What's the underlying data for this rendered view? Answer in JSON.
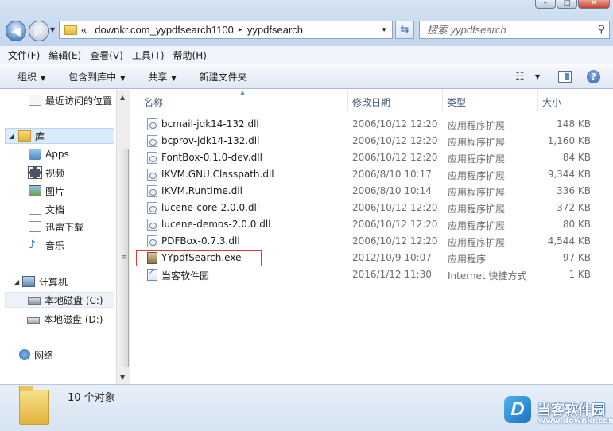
{
  "window": {
    "buttons": {
      "minimize": "–",
      "maximize": "□",
      "close": "✕"
    }
  },
  "address": {
    "overflow": "«",
    "crumbs": [
      "downkr.com_yypdfsearch1100",
      "yypdfsearch"
    ],
    "separator": "▸"
  },
  "search": {
    "placeholder": "搜索 yypdfsearch"
  },
  "menu": [
    "文件(F)",
    "编辑(E)",
    "查看(V)",
    "工具(T)",
    "帮助(H)"
  ],
  "commands": {
    "organize": "组织",
    "include_library": "包含到库中",
    "share": "共享",
    "new_folder": "新建文件夹"
  },
  "nav": {
    "recent": "最近访问的位置",
    "libraries": "库",
    "apps": "Apps",
    "videos": "视频",
    "pictures": "图片",
    "documents": "文档",
    "xunlei": "迅雷下载",
    "music": "音乐",
    "computer": "计算机",
    "drive_c": "本地磁盘 (C:)",
    "drive_d": "本地磁盘 (D:)",
    "network": "网络"
  },
  "columns": {
    "name": "名称",
    "date": "修改日期",
    "type": "类型",
    "size": "大小"
  },
  "files": [
    {
      "name": "bcmail-jdk14-132.dll",
      "date": "2006/10/12 12:20",
      "type": "应用程序扩展",
      "size": "148 KB",
      "icon": "dll-icon"
    },
    {
      "name": "bcprov-jdk14-132.dll",
      "date": "2006/10/12 12:20",
      "type": "应用程序扩展",
      "size": "1,160 KB",
      "icon": "dll-icon"
    },
    {
      "name": "FontBox-0.1.0-dev.dll",
      "date": "2006/10/12 12:20",
      "type": "应用程序扩展",
      "size": "84 KB",
      "icon": "dll-icon"
    },
    {
      "name": "IKVM.GNU.Classpath.dll",
      "date": "2006/8/10 10:17",
      "type": "应用程序扩展",
      "size": "9,344 KB",
      "icon": "dll-icon"
    },
    {
      "name": "IKVM.Runtime.dll",
      "date": "2006/8/10 10:14",
      "type": "应用程序扩展",
      "size": "336 KB",
      "icon": "dll-icon"
    },
    {
      "name": "lucene-core-2.0.0.dll",
      "date": "2006/10/12 12:20",
      "type": "应用程序扩展",
      "size": "372 KB",
      "icon": "dll-icon"
    },
    {
      "name": "lucene-demos-2.0.0.dll",
      "date": "2006/10/12 12:20",
      "type": "应用程序扩展",
      "size": "80 KB",
      "icon": "dll-icon"
    },
    {
      "name": "PDFBox-0.7.3.dll",
      "date": "2006/10/12 12:20",
      "type": "应用程序扩展",
      "size": "4,544 KB",
      "icon": "dll-icon"
    },
    {
      "name": "YYpdfSearch.exe",
      "date": "2012/10/9 10:07",
      "type": "应用程序",
      "size": "97 KB",
      "icon": "exe-icon"
    },
    {
      "name": "当客软件园",
      "date": "2016/1/12 11:30",
      "type": "Internet 快捷方式",
      "size": "1 KB",
      "icon": "shortcut-icon"
    }
  ],
  "status": {
    "count": "10 个对象"
  },
  "watermark": {
    "logo": "D",
    "name": "当客软件园",
    "url": "www.downkr.com"
  },
  "colors": {
    "highlight": "#e23838",
    "selection": "#dcebfc",
    "chrome": "#c3d6ee"
  }
}
